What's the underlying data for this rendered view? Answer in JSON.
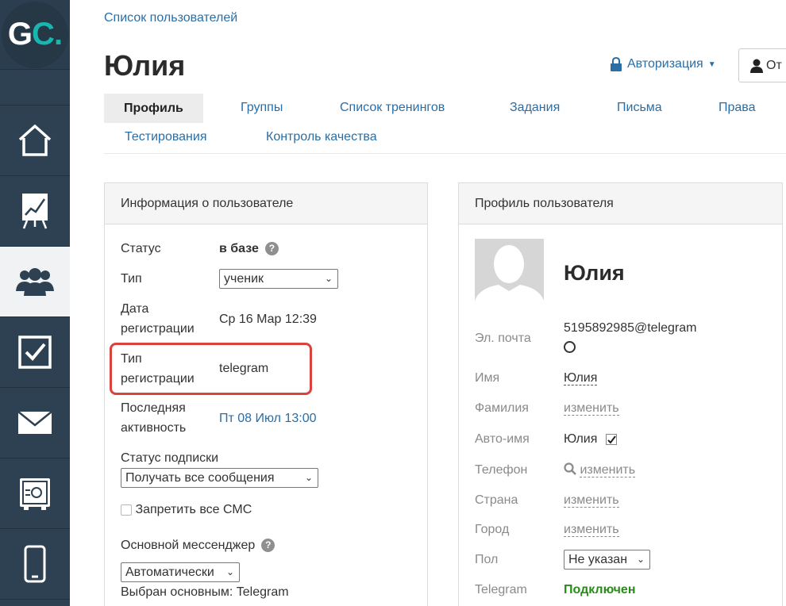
{
  "logo": {
    "g": "G",
    "c": "C",
    "dot": "."
  },
  "sidebar": {
    "items": [
      {
        "icon": "home-icon"
      },
      {
        "icon": "chart-board-icon"
      },
      {
        "icon": "users-icon",
        "active": true
      },
      {
        "icon": "checkbox-icon"
      },
      {
        "icon": "mail-icon"
      },
      {
        "icon": "safe-icon"
      },
      {
        "icon": "phone-icon"
      }
    ]
  },
  "breadcrumb": "Список пользователей",
  "page_title": "Юлия",
  "auth_dropdown": "Авторизация",
  "top_button": "От",
  "tabs": [
    {
      "label": "Профиль",
      "active": true
    },
    {
      "label": "Группы"
    },
    {
      "label": "Список тренингов"
    },
    {
      "label": "Задания"
    },
    {
      "label": "Письма"
    },
    {
      "label": "Права"
    },
    {
      "label": "Тестирования"
    },
    {
      "label": "Контроль качества"
    }
  ],
  "user_info": {
    "title": "Информация о пользователе",
    "status_label": "Статус",
    "status_value": "в базе",
    "type_label": "Тип",
    "type_value": "ученик",
    "reg_date_label_1": "Дата",
    "reg_date_label_2": "регистрации",
    "reg_date_value": "Ср 16 Мар 12:39",
    "reg_type_label_1": "Тип",
    "reg_type_label_2": "регистрации",
    "reg_type_value": "telegram",
    "last_activity_label_1": "Последняя",
    "last_activity_label_2": "активность",
    "last_activity_value": "Пт 08 Июл 13:00",
    "subscription_label": "Статус подписки",
    "subscription_value": "Получать все сообщения",
    "sms_label": "Запретить все СМС",
    "messenger_label": "Основной мессенджер",
    "messenger_value": "Автоматически",
    "messenger_selected": "Выбран основным: Telegram"
  },
  "profile": {
    "title": "Профиль пользователя",
    "name": "Юлия",
    "email_label": "Эл. почта",
    "email_value": "5195892985@telegram",
    "first_name_label": "Имя",
    "first_name_value": "Юлия",
    "last_name_label": "Фамилия",
    "last_name_value": "изменить",
    "auto_name_label": "Авто-имя",
    "auto_name_value": "Юлия",
    "phone_label": "Телефон",
    "phone_value": "изменить",
    "country_label": "Страна",
    "country_value": "изменить",
    "city_label": "Город",
    "city_value": "изменить",
    "gender_label": "Пол",
    "gender_value": "Не указан",
    "telegram_label": "Telegram",
    "telegram_value": "Подключен"
  },
  "colors": {
    "sidebar_bg": "#2e4153",
    "link": "#2a6ea6",
    "accent_teal": "#19b6b0",
    "highlight_red": "#d9433c",
    "connected_green": "#2a8a1a"
  }
}
